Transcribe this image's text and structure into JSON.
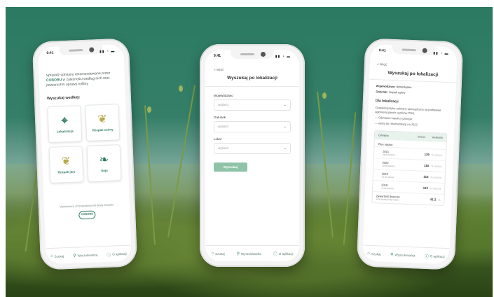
{
  "phone1": {
    "status_time": "9:41",
    "intro_prefix": "Sprawdź odmiany rekomendowane przez",
    "intro_brand": "COBORU",
    "intro_suffix": "w zależności według nich oraz powierzchni uprawy rośliny",
    "choose_label": "Wyszukaj według:",
    "cards": [
      {
        "label": "Lokalizacja"
      },
      {
        "label": "Rzepak ozimy"
      },
      {
        "label": "Rzepak jary"
      },
      {
        "label": "Soja"
      }
    ],
    "footer_text": "Wykonawca i Przewodniczenie Rady Zespołu",
    "logo_text": "COBORU",
    "tabs": [
      "Szukaj",
      "Wyszukiwarka",
      "O aplikacji"
    ]
  },
  "phone2": {
    "status_time": "9:41",
    "back_label": "< Wróć",
    "title": "Wyszukaj po lokalizacji",
    "fields": [
      {
        "label": "Województwo",
        "placeholder": "wybierz"
      },
      {
        "label": "Gatunek",
        "placeholder": "wybierz"
      },
      {
        "label": "Lokal",
        "placeholder": "wybierz"
      }
    ],
    "search_button": "Wyszukaj",
    "tabs": [
      "Szukaj",
      "Wyszukiwarka",
      "O aplikacji"
    ]
  },
  "phone3": {
    "status_time": "9:41",
    "back_label": "< Wróć",
    "title": "Wyszukaj po lokalizacji",
    "meta1_label": "Województwo:",
    "meta1_value": "dolnośląskie",
    "meta2_label": "Gatunek:",
    "meta2_value": "rzepak ozimy",
    "section_title": "Dla lokalizacji",
    "paragraph": "Charakterystyka odmiany sporządzona na podstawie aglomeracyjnych wyników PDO.",
    "bullets": [
      "Odmiana rzepaku ozimego",
      "wpisy do rekomendacji na 2022"
    ],
    "table_head_left": "Odmiana",
    "table_head_right": [
      "Ocena",
      "Wskaźnik"
    ],
    "group_label": "Plon nasion",
    "rows": [
      {
        "name": "2021",
        "sub": "na tle wzorca",
        "value": "116",
        "unit": "% wzorca"
      },
      {
        "name": "2020",
        "sub": "na tle wzorca",
        "value": "116",
        "unit": "% wzorca"
      },
      {
        "name": "2019",
        "sub": "na tle wzorca",
        "value": "116",
        "unit": "% wzorca"
      },
      {
        "name": "2018",
        "sub": "na tle wzorca",
        "value": "112",
        "unit": "% wzorca"
      }
    ],
    "extra_row": {
      "name": "Zawartość tłuszczu",
      "sub": "w % suchej masy nasion",
      "value": "41.2",
      "unit": "%"
    },
    "tabs": [
      "Szukaj",
      "Wyszukiwarka",
      "O aplikacji"
    ]
  }
}
